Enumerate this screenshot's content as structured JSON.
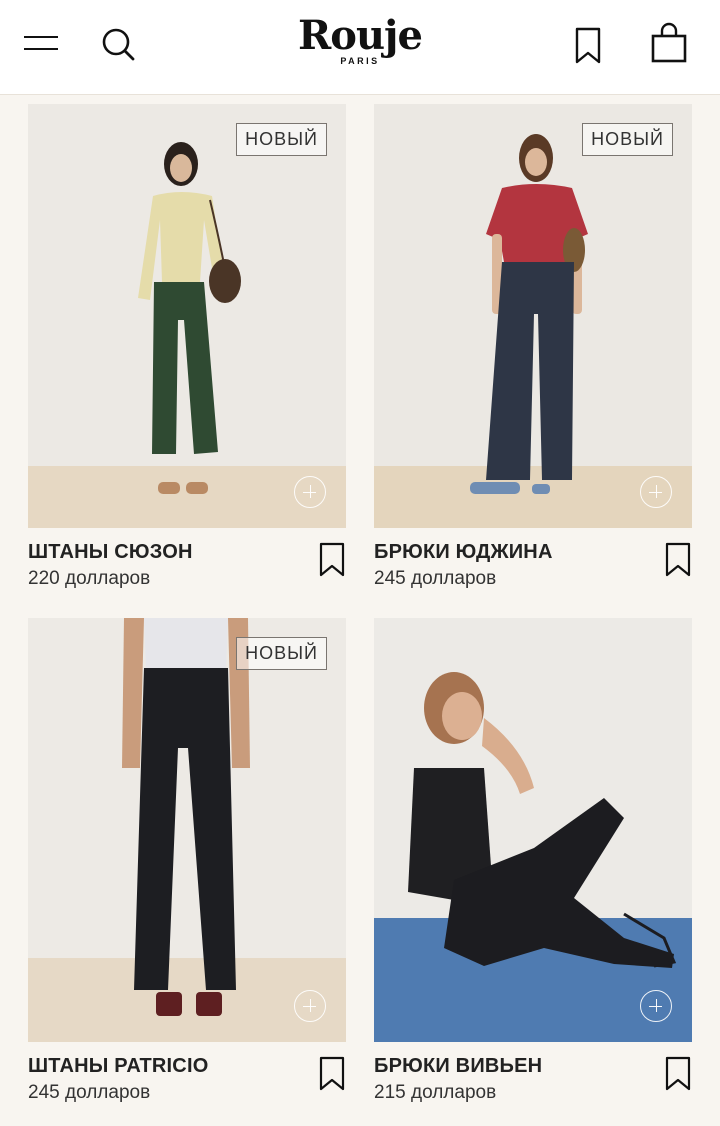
{
  "header": {
    "logo_word": "Rouje",
    "logo_sub": "PARIS",
    "icons": [
      "menu-icon",
      "search-icon",
      "bookmark-icon",
      "shopping-bag-icon"
    ]
  },
  "products": [
    {
      "name": "ШТАНЫ СЮЗОН",
      "price": "220 долларов",
      "badge": "НОВЫЙ"
    },
    {
      "name": "БРЮКИ ЮДЖИНА",
      "price": "245 долларов",
      "badge": "НОВЫЙ"
    },
    {
      "name": "ШТАНЫ PATRICIO",
      "price": "245 долларов",
      "badge": "НОВЫЙ"
    },
    {
      "name": "БРЮКИ ВИВЬЕН",
      "price": "215 долларов",
      "badge": ""
    }
  ],
  "colors": {
    "page_bg": "#f8f5f0",
    "header_bg": "#ffffff",
    "text": "#222222"
  }
}
